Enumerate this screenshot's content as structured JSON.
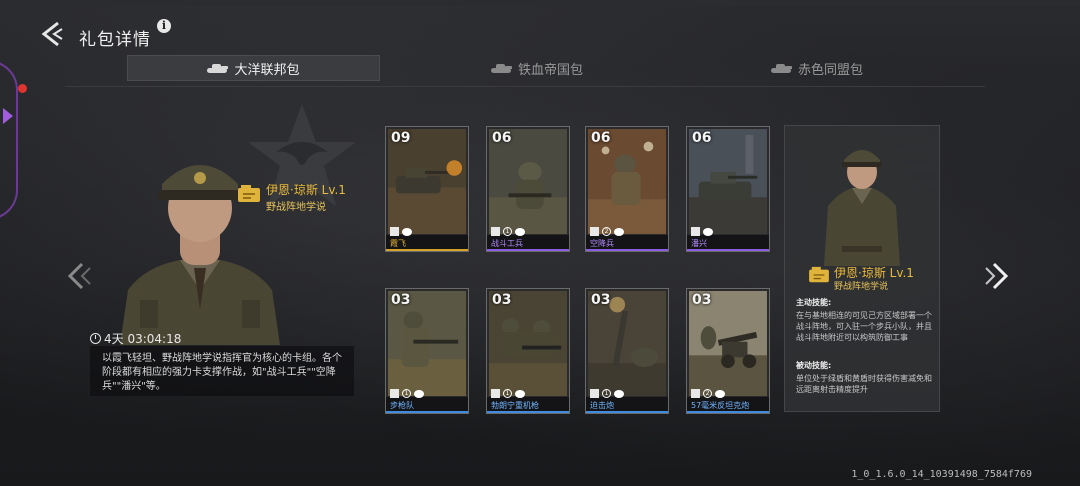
{
  "header": {
    "title": "礼包详情",
    "info": "i"
  },
  "tabs": [
    {
      "label": "大洋联邦包",
      "active": true
    },
    {
      "label": "铁血帝国包",
      "active": false
    },
    {
      "label": "赤色同盟包",
      "active": false
    }
  ],
  "commander": {
    "name": "伊恩·琼斯 Lv.1",
    "skill": "野战阵地学说",
    "timer": "4天 03:04:18",
    "description": "以霞飞轻坦、野战阵地学说指挥官为核心的卡组。各个阶段都有相应的强力卡支撑作战，如\"战斗工兵\"\"空降兵\"\"潘兴\"等。"
  },
  "cards": [
    {
      "count": "09",
      "name": "霞飞",
      "cost": "",
      "rarity": "gold"
    },
    {
      "count": "06",
      "name": "战斗工兵",
      "cost": "1",
      "rarity": "purple"
    },
    {
      "count": "06",
      "name": "空降兵",
      "cost": "2",
      "rarity": "purple"
    },
    {
      "count": "06",
      "name": "潘兴",
      "cost": "",
      "rarity": "purple"
    },
    {
      "count": "03",
      "name": "步枪队",
      "cost": "1",
      "rarity": "blue"
    },
    {
      "count": "03",
      "name": "勃朗宁重机枪",
      "cost": "1",
      "rarity": "blue"
    },
    {
      "count": "03",
      "name": "迫击炮",
      "cost": "1",
      "rarity": "blue"
    },
    {
      "count": "03",
      "name": "57毫米反坦克炮",
      "cost": "2",
      "rarity": "blue"
    }
  ],
  "detail": {
    "name": "伊恩·琼斯 Lv.1",
    "skill": "野战阵地学说",
    "active_title": "主动技能:",
    "active_text": "在与基地相连的可见己方区域部署一个战斗阵地，可入驻一个步兵小队，并且战斗阵地附近可以构筑防御工事",
    "passive_title": "被动技能:",
    "passive_text": "单位处于绿盾和黄盾时获得伤害减免和远距离射击精度提升"
  },
  "version": "1_0_1.6.0_14_10391498_7584f769",
  "colors": {
    "gold": "#d4a32a",
    "purple": "#8a5ce0",
    "blue": "#3f8be0"
  }
}
